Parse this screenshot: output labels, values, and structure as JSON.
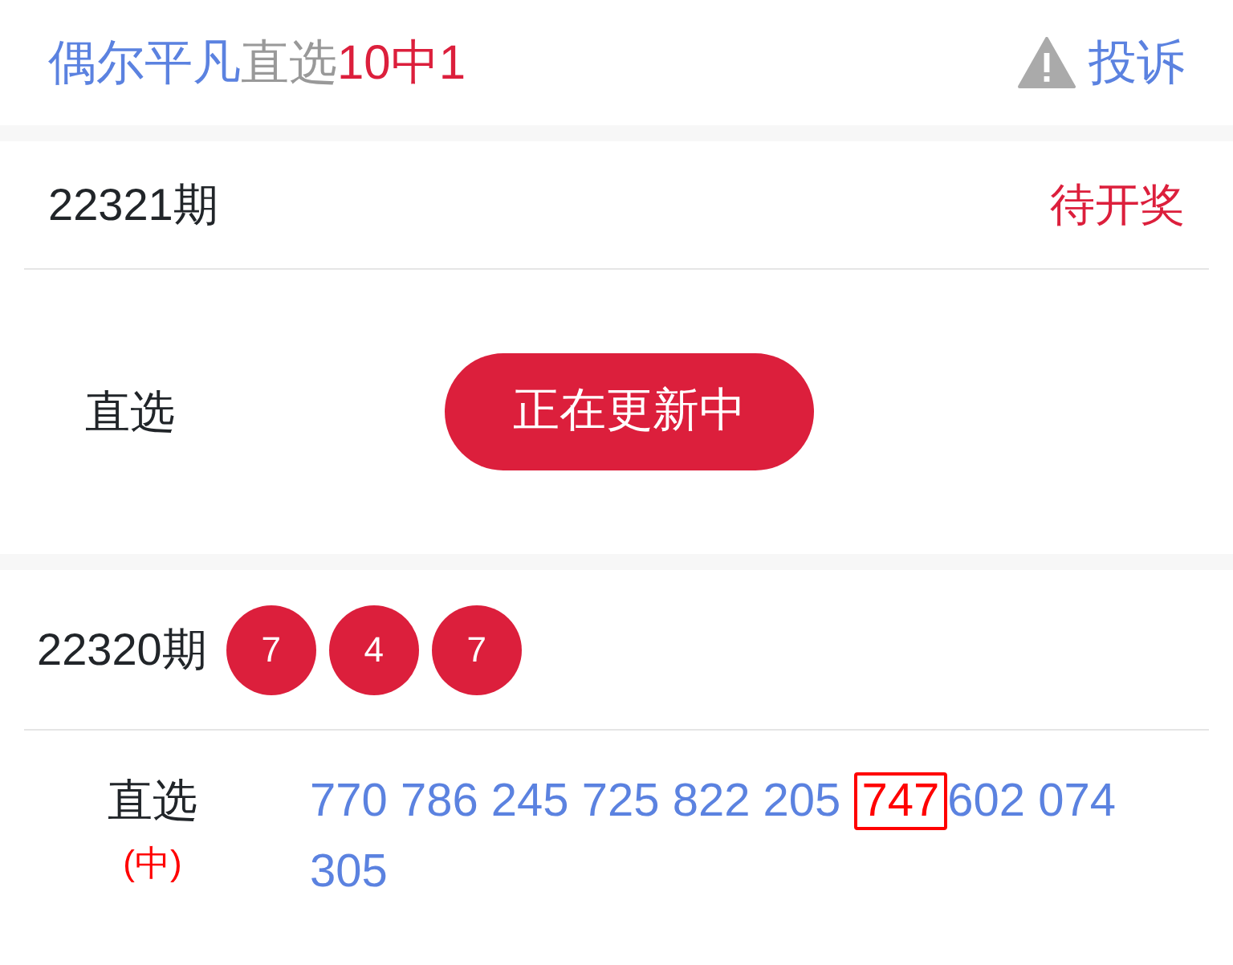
{
  "header": {
    "title_parts": [
      {
        "text": "偶尔平凡",
        "color": "#5b82e0"
      },
      {
        "text": "直选",
        "color": "#999999"
      },
      {
        "text": "10中1",
        "color": "#dc1f3c"
      }
    ],
    "report": "投诉"
  },
  "current": {
    "period": "22321期",
    "status": "待开奖",
    "play": "直选",
    "button": "正在更新中"
  },
  "previous": {
    "period": "22320期",
    "balls": [
      "7",
      "4",
      "7"
    ],
    "play": "直选",
    "result": "(中)",
    "numbers": [
      {
        "text": "770",
        "hit": false
      },
      {
        "text": "786",
        "hit": false
      },
      {
        "text": "245",
        "hit": false
      },
      {
        "text": "725",
        "hit": false
      },
      {
        "text": "822",
        "hit": false
      },
      {
        "text": "205",
        "hit": false
      },
      {
        "text": "747",
        "hit": true
      },
      {
        "text": "602",
        "hit": false
      },
      {
        "text": "074",
        "hit": false
      },
      {
        "text": "305",
        "hit": false
      }
    ]
  }
}
